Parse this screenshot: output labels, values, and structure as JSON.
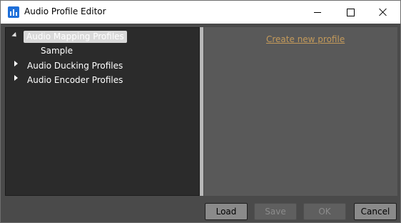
{
  "window": {
    "title": "Audio Profile Editor",
    "controls": [
      "minimize",
      "maximize",
      "close"
    ]
  },
  "tree": {
    "nodes": [
      {
        "label": "Audio Mapping Profiles",
        "expanded": true,
        "selected": true,
        "children": [
          "Sample"
        ]
      },
      {
        "label": "Audio Ducking Profiles",
        "expanded": false
      },
      {
        "label": "Audio Encoder Profiles",
        "expanded": false
      }
    ]
  },
  "actions": {
    "create_new_profile": "Create new profile"
  },
  "buttons": {
    "load": "Load",
    "save": "Save",
    "ok": "OK",
    "cancel": "Cancel"
  },
  "colors": {
    "titlebar": "#ffffff",
    "tree_background": "#2b2b2b",
    "detail_background": "#595959",
    "link": "#c49a5a"
  }
}
